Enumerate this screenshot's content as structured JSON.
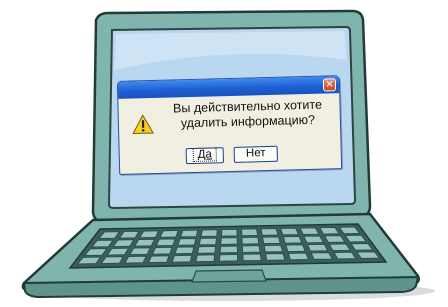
{
  "dialog": {
    "close_glyph": "✕",
    "message_line1": "Вы действительно хотите",
    "message_line2": "удалить информацию?",
    "yes_label": "Да",
    "no_label": "Нет",
    "icon": "warning-icon"
  },
  "colors": {
    "laptop_body": "#7fb5ad",
    "screen": "#b9d7ee",
    "titlebar": "#1f5fd1",
    "dialog_bg": "#f1efe2",
    "close_button": "#d35a35"
  }
}
